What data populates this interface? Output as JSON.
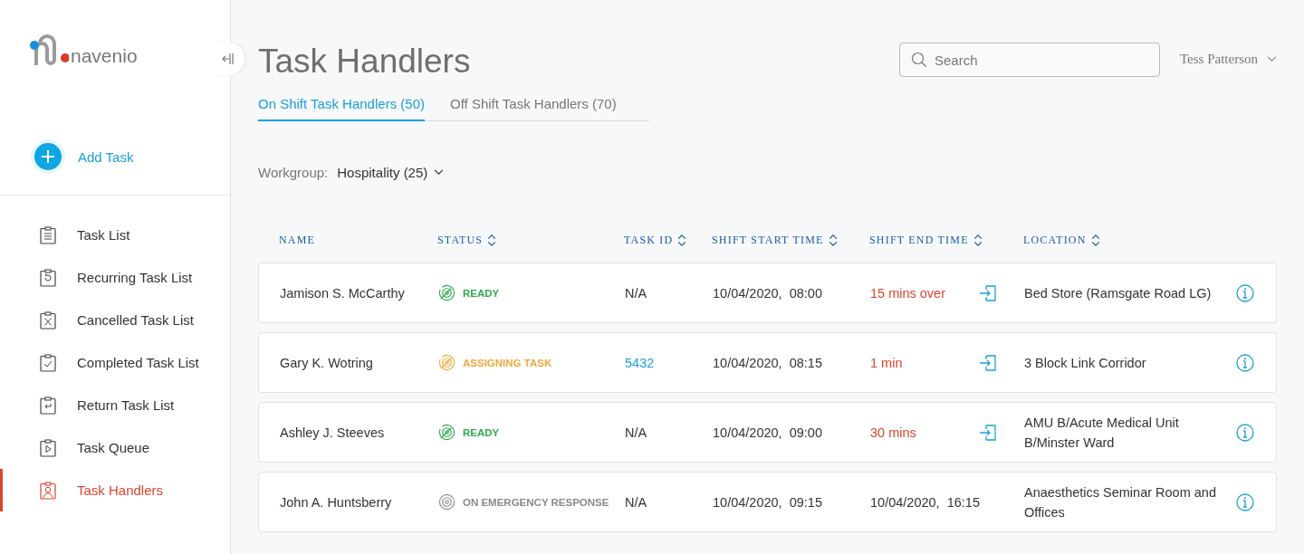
{
  "sidebar": {
    "logo_text": "navenio",
    "add_task": "Add Task",
    "items": [
      {
        "label": "Task List",
        "selected": false
      },
      {
        "label": "Recurring Task List",
        "selected": false
      },
      {
        "label": "Cancelled Task List",
        "selected": false
      },
      {
        "label": "Completed Task List",
        "selected": false
      },
      {
        "label": "Return Task List",
        "selected": false
      },
      {
        "label": "Task Queue",
        "selected": false
      },
      {
        "label": "Task Handlers",
        "selected": true
      }
    ]
  },
  "header": {
    "title": "Task Handlers",
    "search": {
      "placeholder": "Search"
    },
    "user": "Tess Patterson"
  },
  "tabs": [
    {
      "label": "On Shift Task Handlers (50)",
      "selected": true
    },
    {
      "label": "Off Shift Task Handlers (70)",
      "selected": false
    }
  ],
  "filter": {
    "label": "Workgroup:",
    "value": "Hospitality (25)"
  },
  "table": {
    "columns": [
      {
        "label": "NAME",
        "sortable": false
      },
      {
        "label": "STATUS",
        "sortable": true
      },
      {
        "label": "TASK ID",
        "sortable": true
      },
      {
        "label": "SHIFT START TIME",
        "sortable": true
      },
      {
        "label": "SHIFT END TIME",
        "sortable": true
      },
      {
        "label": "LOCATION",
        "sortable": true
      }
    ],
    "rows": [
      {
        "name": "Jamison S. McCarthy",
        "status": {
          "label": "READY",
          "kind": "ready"
        },
        "task_id": "N/A",
        "start": "10/04/2020,  08:00",
        "end": {
          "text": "15 mins over",
          "kind": "countdown"
        },
        "location": "Bed Store (Ramsgate Road LG)"
      },
      {
        "name": "Gary K. Wotring",
        "status": {
          "label": "ASSIGNING TASK",
          "kind": "assigning"
        },
        "task_id": "5432",
        "start": "10/04/2020,  08:15",
        "end": {
          "text": "1 min",
          "kind": "countdown"
        },
        "location": "3 Block Link Corridor"
      },
      {
        "name": "Ashley J. Steeves",
        "status": {
          "label": "READY",
          "kind": "ready"
        },
        "task_id": "N/A",
        "start": "10/04/2020,  09:00",
        "end": {
          "text": "30 mins",
          "kind": "countdown"
        },
        "location": "AMU B/Acute Medical Unit B/Minster Ward"
      },
      {
        "name": "John A. Huntsberry",
        "status": {
          "label": "ON EMERGENCY RESPONSE",
          "kind": "emergency"
        },
        "task_id": "N/A",
        "start": "10/04/2020,  09:15",
        "end": {
          "text": "10/04/2020,  16:15",
          "kind": "time"
        },
        "location": "Anaesthetics Seminar Room and Offices"
      }
    ]
  }
}
